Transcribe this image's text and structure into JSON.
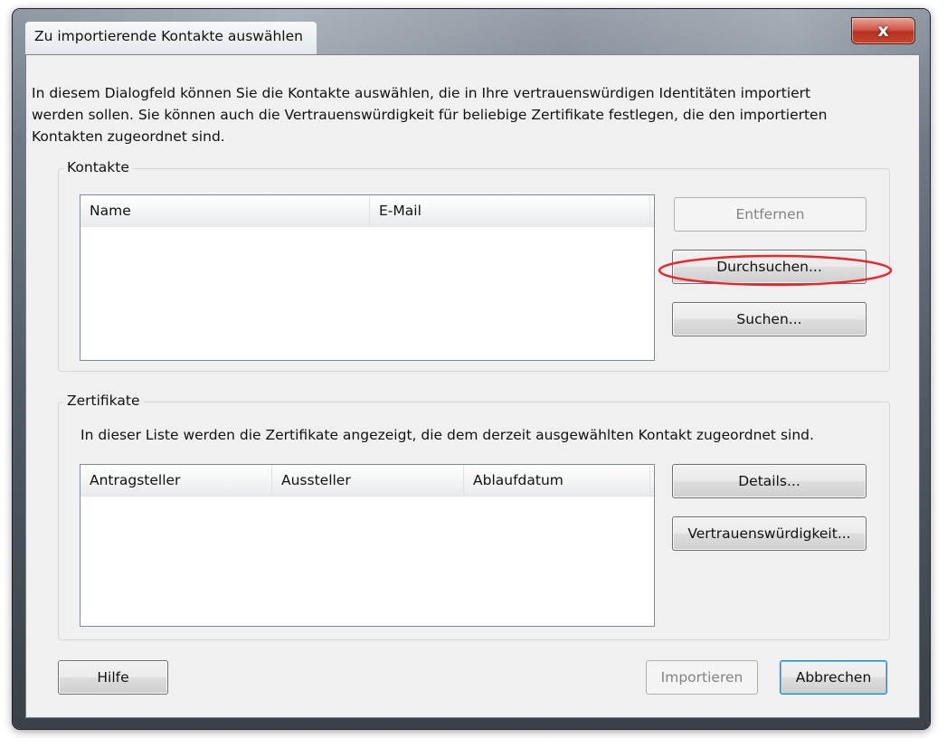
{
  "window": {
    "title": "Zu importierende Kontakte auswählen",
    "close_label": "x"
  },
  "intro_lines": [
    "In diesem Dialogfeld können Sie die Kontakte auswählen, die in Ihre vertrauenswürdigen Identitäten importiert",
    "werden sollen. Sie können auch die Vertrauenswürdigkeit für beliebige Zertifikate festlegen, die den importierten",
    "Kontakten zugeordnet sind."
  ],
  "contacts": {
    "group_label": "Kontakte",
    "columns": [
      "Name",
      "E-Mail"
    ],
    "rows": [],
    "buttons": {
      "remove": "Entfernen",
      "browse": "Durchsuchen...",
      "search": "Suchen..."
    }
  },
  "certificates": {
    "group_label": "Zertifikate",
    "description": "In dieser Liste werden die Zertifikate angezeigt, die dem derzeit ausgewählten Kontakt zugeordnet sind.",
    "columns": [
      "Antragsteller",
      "Aussteller",
      "Ablaufdatum"
    ],
    "rows": [],
    "buttons": {
      "details": "Details...",
      "trust": "Vertrauenswürdigkeit..."
    }
  },
  "footer": {
    "help": "Hilfe",
    "import": "Importieren",
    "cancel": "Abbrechen"
  },
  "colors": {
    "annotation": "#e8262d"
  }
}
